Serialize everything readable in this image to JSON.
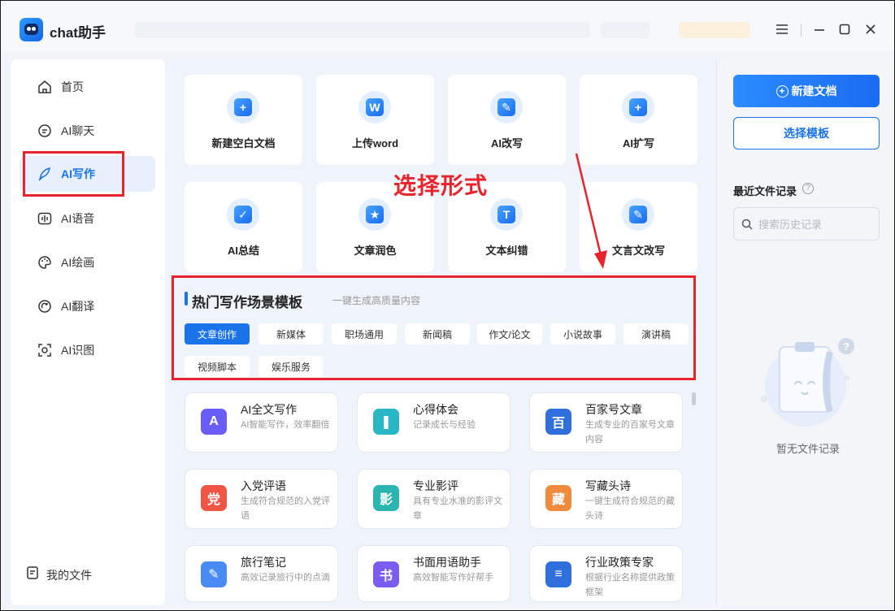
{
  "app": {
    "title": "chat助手"
  },
  "sidebar": {
    "items": [
      {
        "label": "首页",
        "icon": "home-icon"
      },
      {
        "label": "AI聊天",
        "icon": "chat-icon"
      },
      {
        "label": "AI写作",
        "icon": "feather-icon"
      },
      {
        "label": "AI语音",
        "icon": "audio-wave-icon"
      },
      {
        "label": "AI绘画",
        "icon": "palette-icon"
      },
      {
        "label": "AI翻译",
        "icon": "translate-icon"
      },
      {
        "label": "AI识图",
        "icon": "scan-image-icon"
      }
    ],
    "active_index": 2,
    "footer_label": "我的文件"
  },
  "tools": [
    {
      "label": "新建空白文档",
      "icon": "add-document-icon",
      "glyph": "+"
    },
    {
      "label": "上传word",
      "icon": "word-upload-icon",
      "glyph": "W"
    },
    {
      "label": "AI改写",
      "icon": "pen-rewrite-icon",
      "glyph": "✎"
    },
    {
      "label": "AI扩写",
      "icon": "feather-plus-icon",
      "glyph": "+"
    },
    {
      "label": "AI总结",
      "icon": "summary-check-icon",
      "glyph": "✓"
    },
    {
      "label": "文章润色",
      "icon": "polish-star-icon",
      "glyph": "★"
    },
    {
      "label": "文本纠错",
      "icon": "text-correct-icon",
      "glyph": "T"
    },
    {
      "label": "文言文改写",
      "icon": "classical-rewrite-icon",
      "glyph": "✎"
    }
  ],
  "annotation": {
    "text": "选择形式"
  },
  "hot": {
    "title": "热门写作场景模板",
    "subtitle": "一键生成高质量内容",
    "chips": [
      "文章创作",
      "新媒体",
      "职场通用",
      "新闻稿",
      "作文/论文",
      "小说故事",
      "演讲稿",
      "视频脚本",
      "娱乐服务"
    ],
    "active_chip": 0
  },
  "templates": [
    {
      "title": "AI全文写作",
      "desc": "AI智能写作，效率翻倍",
      "icon": "ai-fulltext-icon",
      "glyph": "A",
      "color": "#6a5cf6"
    },
    {
      "title": "心得体会",
      "desc": "记录成长与经验",
      "icon": "notebook-icon",
      "glyph": "❚",
      "color": "#29b6c5"
    },
    {
      "title": "百家号文章",
      "desc": "生成专业的百家号文章内容",
      "icon": "baijia-icon",
      "glyph": "百",
      "color": "#2f6fdd"
    },
    {
      "title": "入党评语",
      "desc": "生成符合规范的入党评语",
      "icon": "party-comment-icon",
      "glyph": "党",
      "color": "#f05545"
    },
    {
      "title": "专业影评",
      "desc": "具有专业水准的影评文章",
      "icon": "film-review-icon",
      "glyph": "影",
      "color": "#2bb5b0"
    },
    {
      "title": "写藏头诗",
      "desc": "一键生成符合规范的藏头诗",
      "icon": "acrostic-poem-icon",
      "glyph": "藏",
      "color": "#f08a3c"
    },
    {
      "title": "旅行笔记",
      "desc": "高效记录旅行中的点滴",
      "icon": "travel-note-icon",
      "glyph": "✎",
      "color": "#4a8af4"
    },
    {
      "title": "书面用语助手",
      "desc": "高效智能写作好帮手",
      "icon": "written-language-icon",
      "glyph": "书",
      "color": "#7a5cf0"
    },
    {
      "title": "行业政策专家",
      "desc": "根据行业名称提供政策框架",
      "icon": "policy-doc-icon",
      "glyph": "≡",
      "color": "#2f6fdd"
    }
  ],
  "right": {
    "new_doc_label": "新建文档",
    "template_label": "选择模板",
    "recent_title": "最近文件记录",
    "search_placeholder": "搜索历史记录",
    "empty_text": "暂无文件记录"
  }
}
